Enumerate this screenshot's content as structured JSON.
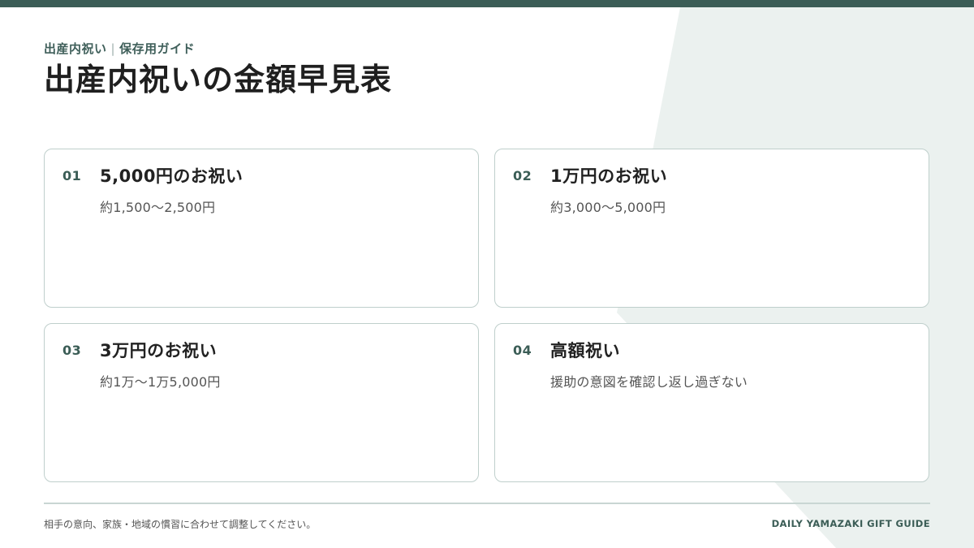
{
  "header": {
    "eyebrow_category": "出産内祝い",
    "eyebrow_separator": "|",
    "eyebrow_section": "保存用ガイド",
    "title": "出産内祝いの金額早見表"
  },
  "cards": [
    {
      "number": "01",
      "title": "5,000円のお祝い",
      "text": "約1,500〜2,500円"
    },
    {
      "number": "02",
      "title": "1万円のお祝い",
      "text": "約3,000〜5,000円"
    },
    {
      "number": "03",
      "title": "3万円のお祝い",
      "text": "約1万〜1万5,000円"
    },
    {
      "number": "04",
      "title": "高額祝い",
      "text": "援助の意図を確認し返し過ぎない"
    }
  ],
  "footer": {
    "note": "相手の意向、家族・地域の慣習に合わせて調整してください。",
    "brand": "DAILY YAMAZAKI GIFT GUIDE"
  },
  "colors": {
    "accent": "#3b5d56",
    "background_shape": "#ebf1ef",
    "card_border": "#bfcfcc"
  }
}
